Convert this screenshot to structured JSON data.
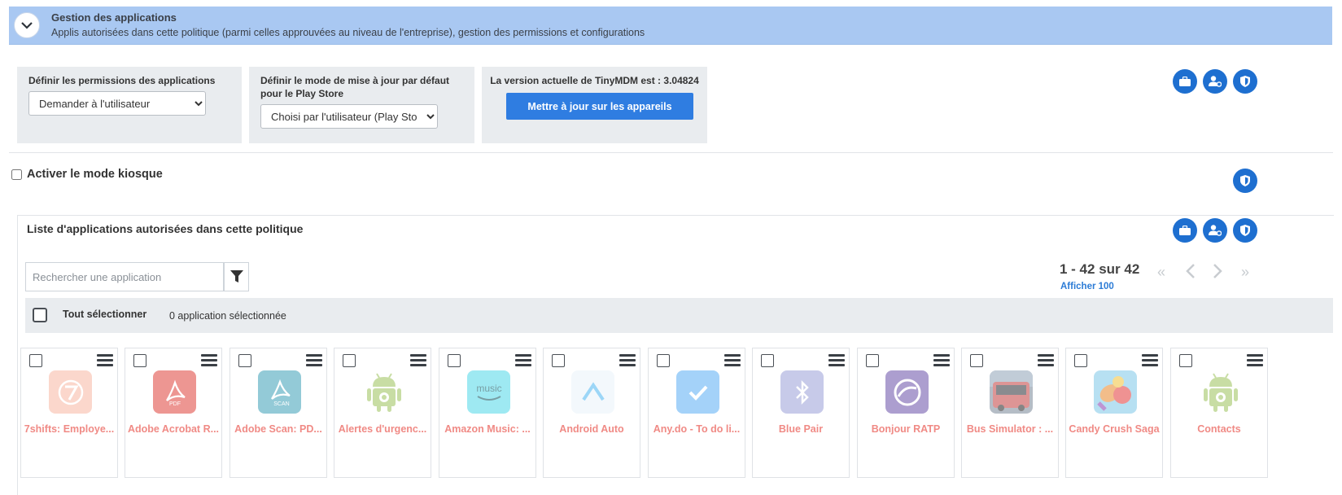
{
  "header": {
    "title": "Gestion des applications",
    "subtitle": "Applis autorisées dans cette politique (parmi celles approuvées au niveau de l'entreprise), gestion des permissions et configurations"
  },
  "settings": {
    "permissions": {
      "label": "Définir les permissions des applications",
      "value": "Demander à l'utilisateur"
    },
    "update_mode": {
      "label": "Définir le mode de mise à jour par défaut pour le Play Store",
      "value": "Choisi par l'utilisateur (Play Store)"
    },
    "version": {
      "label": "La version actuelle de TinyMDM est : 3.04824",
      "button": "Mettre à jour sur les appareils"
    }
  },
  "kiosk": {
    "label": "Activer le mode kiosque",
    "checked": false
  },
  "list": {
    "title": "Liste d'applications autorisées dans cette politique",
    "search_placeholder": "Rechercher une application",
    "pagination": {
      "range": "1 - 42 sur 42",
      "show_more": "Afficher 100"
    },
    "select_all": "Tout sélectionner",
    "selected_count": "0 application sélectionnée",
    "apps": [
      {
        "name": "7shifts: Employe...",
        "icon": "7shifts-icon",
        "color": "#f7a08c"
      },
      {
        "name": "Adobe Acrobat R...",
        "icon": "adobe-acrobat-icon",
        "color": "#e0413a"
      },
      {
        "name": "Adobe Scan: PD...",
        "icon": "adobe-scan-icon",
        "color": "#3b9fb8"
      },
      {
        "name": "Alertes d'urgenc...",
        "icon": "android-icon",
        "color": "#a8c878"
      },
      {
        "name": "Amazon Music: ...",
        "icon": "amazon-music-icon",
        "color": "#4fd8e8"
      },
      {
        "name": "Android Auto",
        "icon": "android-auto-icon",
        "color": "#4cb6f2"
      },
      {
        "name": "Any.do - To do li...",
        "icon": "anydo-icon",
        "color": "#5aaef5"
      },
      {
        "name": "Blue Pair",
        "icon": "bluetooth-icon",
        "color": "#9aa0d8"
      },
      {
        "name": "Bonjour RATP",
        "icon": "ratp-icon",
        "color": "#6a4fa8"
      },
      {
        "name": "Bus Simulator : ...",
        "icon": "bus-simulator-icon",
        "color": "#c24040"
      },
      {
        "name": "Candy Crush Saga",
        "icon": "candy-crush-icon",
        "color": "#e8882c"
      },
      {
        "name": "Contacts",
        "icon": "android-icon",
        "color": "#a8c878"
      }
    ]
  }
}
